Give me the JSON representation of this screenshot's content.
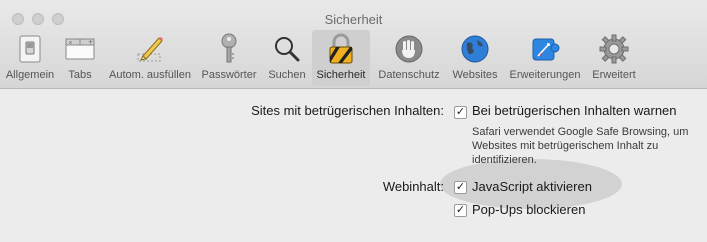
{
  "window": {
    "title": "Sicherheit"
  },
  "toolbar": {
    "items": [
      {
        "label": "Allgemein",
        "icon": "switch-icon"
      },
      {
        "label": "Tabs",
        "icon": "tabs-icon"
      },
      {
        "label": "Autom. ausfüllen",
        "icon": "pencil-icon"
      },
      {
        "label": "Passwörter",
        "icon": "key-icon"
      },
      {
        "label": "Suchen",
        "icon": "magnifier-icon"
      },
      {
        "label": "Sicherheit",
        "icon": "lock-icon",
        "selected": true
      },
      {
        "label": "Datenschutz",
        "icon": "hand-icon"
      },
      {
        "label": "Websites",
        "icon": "globe-icon"
      },
      {
        "label": "Erweiterungen",
        "icon": "puzzle-icon"
      },
      {
        "label": "Erweitert",
        "icon": "gear-icon"
      }
    ]
  },
  "security": {
    "fraud_label": "Sites mit betrügerischen Inhalten:",
    "fraud_checkbox": {
      "label": "Bei betrügerischen Inhalten warnen",
      "checked": true
    },
    "fraud_note": "Safari verwendet Google Safe Browsing, um Websites mit betrügerischem Inhalt zu identifizieren.",
    "web_label": "Webinhalt:",
    "javascript_checkbox": {
      "label": "JavaScript aktivieren",
      "checked": true
    },
    "popups_checkbox": {
      "label": "Pop-Ups blockieren",
      "checked": true
    },
    "check_glyph": "✓"
  },
  "colors": {
    "selected_tab_bg": "#cfcfcf",
    "highlight": "#9a9a9a"
  }
}
